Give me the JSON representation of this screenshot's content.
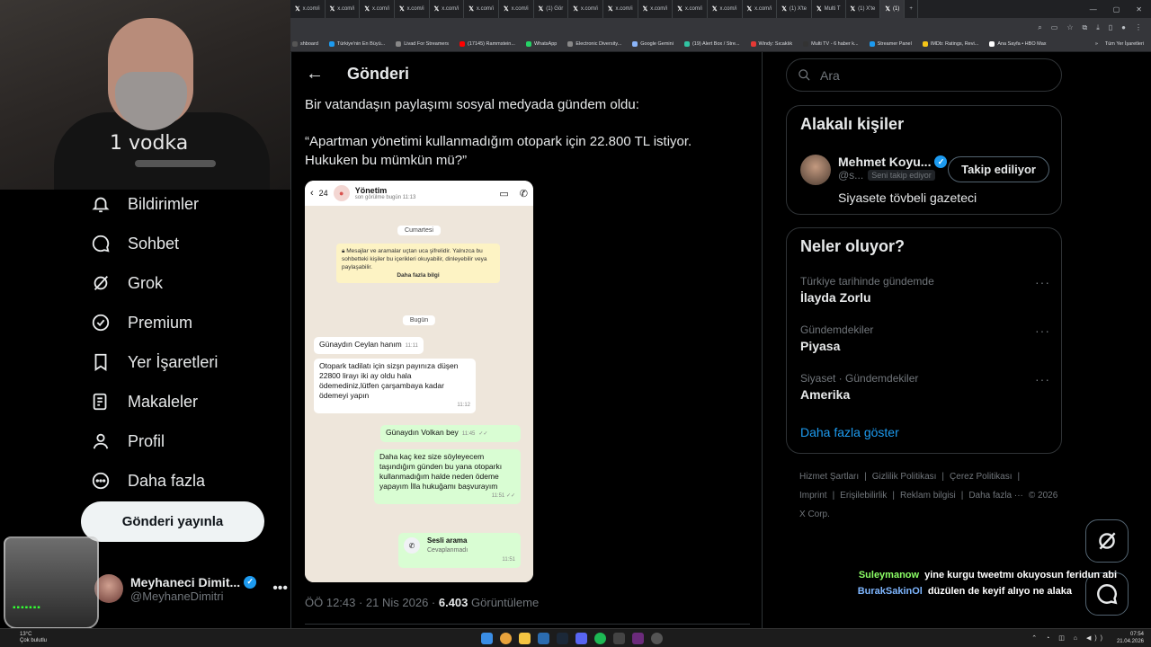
{
  "browser": {
    "tabs": [
      {
        "label": "x.com/i"
      },
      {
        "label": "x.com/i"
      },
      {
        "label": "x.com/i"
      },
      {
        "label": "x.com/i"
      },
      {
        "label": "x.com/i"
      },
      {
        "label": "x.com/i"
      },
      {
        "label": "x.com/i"
      },
      {
        "label": "(1) Gör"
      },
      {
        "label": "x.com/i"
      },
      {
        "label": "x.com/i"
      },
      {
        "label": "x.com/i"
      },
      {
        "label": "x.com/i"
      },
      {
        "label": "x.com/i"
      },
      {
        "label": "x.com/i"
      },
      {
        "label": "(1) X'te"
      },
      {
        "label": "Multi T"
      },
      {
        "label": "(1) X'te"
      },
      {
        "label": "(1)"
      }
    ],
    "bookmarks": [
      {
        "label": "shboard",
        "color": "#555"
      },
      {
        "label": "Türkiye'nin En Büyü...",
        "color": "#1d9bf0"
      },
      {
        "label": "Livad For Streamers",
        "color": "#888"
      },
      {
        "label": "(17145) Rammstein...",
        "color": "#ff0000"
      },
      {
        "label": "WhatsApp",
        "color": "#25d366"
      },
      {
        "label": "Electronic Diversity...",
        "color": "#888"
      },
      {
        "label": "Google Gemini",
        "color": "#8ab4f8"
      },
      {
        "label": "(19) Alert Box / Stre...",
        "color": "#31c3a2"
      },
      {
        "label": "Windy: Sıcaklık",
        "color": "#e53935"
      },
      {
        "label": "Multi TV - 6 haber k...",
        "color": "#333"
      },
      {
        "label": "Streamer Panel",
        "color": "#1d9bf0"
      },
      {
        "label": "IMDb: Ratings, Revi...",
        "color": "#f5c518"
      },
      {
        "label": "Ana Sayfa • HBO Max",
        "color": "#fff"
      }
    ],
    "all_bookmarks": "Tüm Yer İşaretleri"
  },
  "webcam": {
    "shirt_text": "1 vodka"
  },
  "nav": {
    "items": [
      {
        "label": "Bildirimler",
        "icon": "bell-icon"
      },
      {
        "label": "Sohbet",
        "icon": "chat-icon"
      },
      {
        "label": "Grok",
        "icon": "grok-icon"
      },
      {
        "label": "Premium",
        "icon": "verified-icon"
      },
      {
        "label": "Yer İşaretleri",
        "icon": "bookmark-icon"
      },
      {
        "label": "Makaleler",
        "icon": "article-icon"
      },
      {
        "label": "Profil",
        "icon": "profile-icon"
      },
      {
        "label": "Daha fazla",
        "icon": "more-icon"
      }
    ],
    "post_button": "Gönderi yayınla",
    "profile": {
      "name": "Meyhaneci Dimit...",
      "handle": "@MeyhaneDimitri",
      "more": "•••"
    }
  },
  "main": {
    "title": "Gönderi",
    "tweet_line1": "Bir vatandaşın paylaşımı sosyal medyada gündem oldu:",
    "tweet_line2": "“Apartman yönetimi kullanmadığım otopark için 22.800 TL istiyor. Hukuken bu mümkün mü?”",
    "meta_time": "ÖÖ 12:43 · 21 Nis 2026 · ",
    "views": "6.403",
    "views_label": " Görüntüleme"
  },
  "whatsapp": {
    "back_count": "24",
    "contact": "Yönetim",
    "last_seen": "son görülme bugün 11:13",
    "day1": "Cumartesi",
    "encryption": "Mesajlar ve aramalar uçtan uca şifrelidir. Yalnızca bu sohbetteki kişiler bu içerikleri okuyabilir, dinleyebilir veya paylaşabilir.",
    "encryption_more": "Daha fazla bilgi",
    "day2": "Bugün",
    "msg1": "Günaydın Ceylan hanım",
    "msg1_time": "11:11",
    "msg2": "Otopark tadilatı için sizşn payınıza düşen 22800 lirayı iki ay oldu hala ödemediniz,lütfen çarşambaya kadar ödemeyi yapın",
    "msg2_time": "11:12",
    "msg3": "Günaydın Volkan bey",
    "msg3_time": "11:45",
    "msg4": "Daha kaç kez size söyleyecem taşındığım günden bu yana otoparkı kullanmadığım halde neden ödeme yapayım İlla hukuğamı başvurayım",
    "msg4_time": "11:51",
    "call_title": "Sesli arama",
    "call_sub": "Cevaplanmadı",
    "call_time": "11:51"
  },
  "right": {
    "search_placeholder": "Ara",
    "related_title": "Alakalı kişiler",
    "related_name": "Mehmet Koyu...",
    "related_handle": "@s...",
    "follows_you": "Seni takip ediyor",
    "follow_button": "Takip ediliyor",
    "related_bio": "Siyasete tövbeli gazeteci",
    "trends_title": "Neler oluyor?",
    "trends": [
      {
        "context": "Türkiye tarihinde gündemde",
        "name": "İlayda Zorlu"
      },
      {
        "context": "Gündemdekiler",
        "name": "Piyasa"
      },
      {
        "context": "Siyaset · Gündemdekiler",
        "name": "Amerika"
      }
    ],
    "show_more": "Daha fazla göster",
    "footer": [
      "Hizmet Şartları",
      "|",
      "Gizlilik Politikası",
      "|",
      "Çerez Politikası",
      "|",
      "Imprint",
      "|",
      "Erişilebilirlik",
      "|",
      "Reklam bilgisi",
      "|",
      "Daha fazla ···",
      "© 2026 X Corp."
    ]
  },
  "stream_chat": [
    {
      "user": "Suleymanow",
      "message": "yine kurgu tweetmı okuyosun feridun abi"
    },
    {
      "user": "BurakSakinOl",
      "message": "düzülen de keyif alıyo ne alaka"
    }
  ],
  "taskbar": {
    "weather_temp": "13°C",
    "weather_desc": "Çok bulutlu",
    "time": "07:54",
    "date": "21.04.2026"
  }
}
